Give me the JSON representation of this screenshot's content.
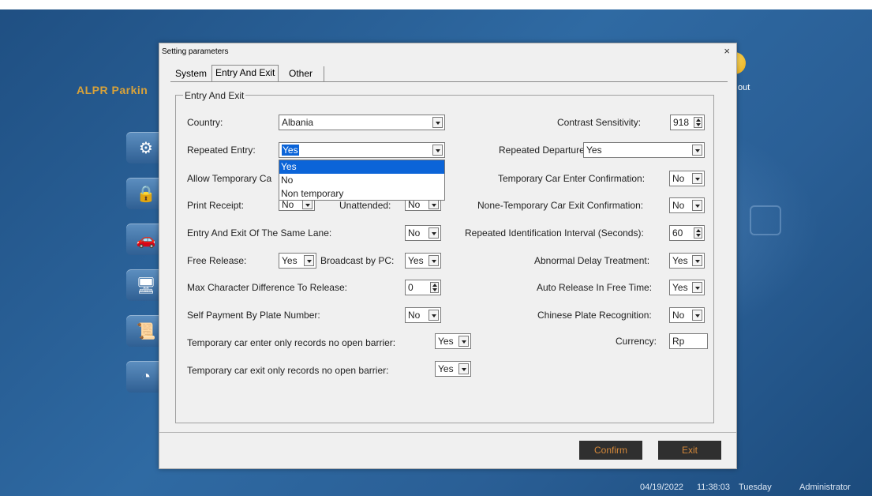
{
  "background": {
    "app_title": "ALPR Parkin",
    "logout_label": "out",
    "status": {
      "date": "04/19/2022",
      "time": "11:38:03",
      "weekday": "Tuesday",
      "user": "Administrator"
    }
  },
  "dialog": {
    "title": "Setting parameters",
    "close": "×",
    "tabs": {
      "system": "System",
      "entry_exit": "Entry And Exit",
      "other": "Other"
    },
    "group_label": "Entry And Exit",
    "fields": {
      "country": {
        "label": "Country:",
        "value": "Albania"
      },
      "contrast": {
        "label": "Contrast Sensitivity:",
        "value": "918"
      },
      "repeated_entry": {
        "label": "Repeated Entry:",
        "value": "Yes"
      },
      "repeated_departure": {
        "label": "Repeated Departure:",
        "value": "Yes"
      },
      "allow_temporary": {
        "label": "Allow Temporary Ca"
      },
      "temp_enter_confirm": {
        "label": "Temporary Car Enter Confirmation:",
        "value": "No"
      },
      "print_receipt": {
        "label": "Print Receipt:",
        "value": "No"
      },
      "unattended": {
        "label": "Unattended:",
        "value": "No"
      },
      "none_temp_exit_confirm": {
        "label": "None-Temporary Car Exit Confirmation:",
        "value": "No"
      },
      "same_lane": {
        "label": "Entry And Exit Of The Same Lane:",
        "value": "No"
      },
      "repeat_interval": {
        "label": "Repeated Identification Interval (Seconds):",
        "value": "60"
      },
      "free_release": {
        "label": "Free Release:",
        "value": "Yes"
      },
      "broadcast_pc": {
        "label": "Broadcast by PC:",
        "value": "Yes"
      },
      "abnormal_delay": {
        "label": "Abnormal Delay Treatment:",
        "value": "Yes"
      },
      "max_char_diff": {
        "label": "Max Character Difference To Release:",
        "value": "0"
      },
      "auto_release": {
        "label": "Auto Release In Free Time:",
        "value": "Yes"
      },
      "self_payment": {
        "label": "Self Payment By Plate Number:",
        "value": "No"
      },
      "chinese_plate": {
        "label": "Chinese Plate Recognition:",
        "value": "No"
      },
      "temp_enter_no_barrier": {
        "label": "Temporary car enter only records no open barrier:",
        "value": "Yes"
      },
      "currency": {
        "label": "Currency:",
        "value": "Rp"
      },
      "temp_exit_no_barrier": {
        "label": "Temporary car exit only records no open barrier:",
        "value": "Yes"
      }
    },
    "dropdown_options": [
      "Yes",
      "No",
      "Non temporary"
    ],
    "buttons": {
      "confirm": "Confirm",
      "exit": "Exit"
    }
  }
}
